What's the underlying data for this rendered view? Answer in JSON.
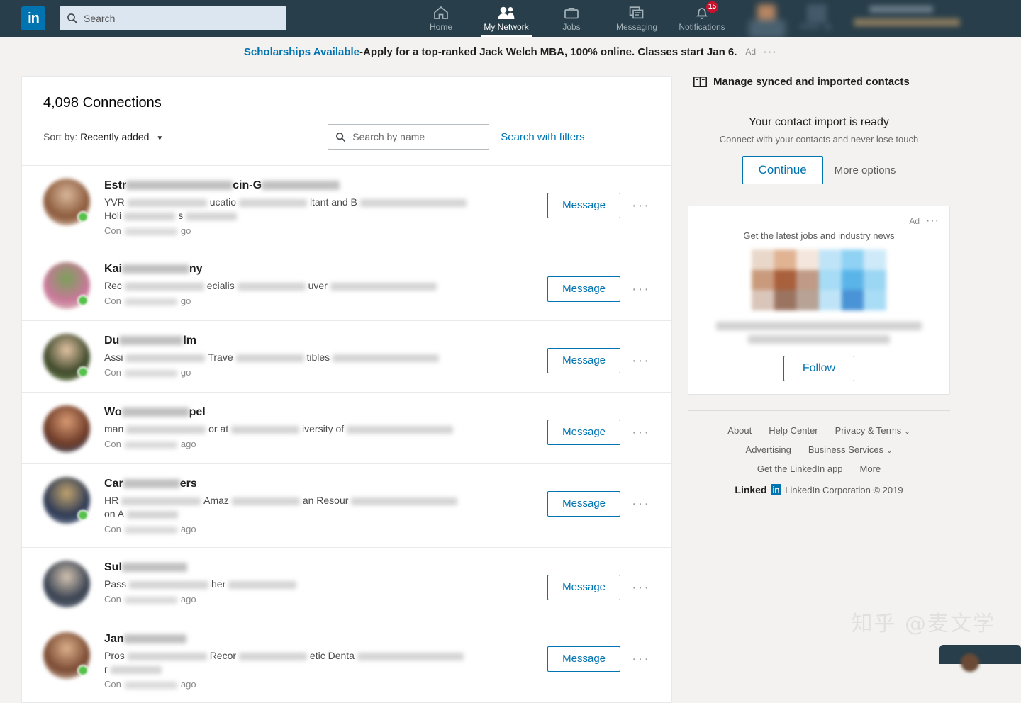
{
  "nav": {
    "logo_text": "in",
    "search_placeholder": "Search",
    "search_value": "",
    "items": [
      {
        "label": "Home",
        "icon": "home-icon",
        "active": false,
        "badge": ""
      },
      {
        "label": "My Network",
        "icon": "people-icon",
        "active": true,
        "badge": ""
      },
      {
        "label": "Jobs",
        "icon": "briefcase-icon",
        "active": false,
        "badge": ""
      },
      {
        "label": "Messaging",
        "icon": "chat-icon",
        "active": false,
        "badge": ""
      },
      {
        "label": "Notifications",
        "icon": "bell-icon",
        "active": false,
        "badge": "15"
      }
    ],
    "badge_color": "#cb112d",
    "bar_color": "#283e4a"
  },
  "ad_banner": {
    "headline": "Scholarships Available",
    "separator": " - ",
    "body": "Apply for a top-ranked Jack Welch MBA, 100% online. Classes start Jan 6.",
    "ad_tag": "Ad",
    "overflow": "···"
  },
  "connections": {
    "title": "4,098 Connections",
    "sort_label": "Sort by:",
    "sort_value": "Recently added",
    "sort_caret": "▼",
    "search_placeholder": "Search by name",
    "search_value": "",
    "filters_link": "Search with filters",
    "message_label": "Message",
    "row_overflow": "···",
    "rows": [
      {
        "name_visible": "Estr",
        "name_mid": "cin-G",
        "title_parts": [
          "YVR",
          "ucatio",
          "ltant and B"
        ],
        "title_line2": [
          "Holi",
          "s"
        ],
        "connected_prefix": "Con",
        "connected_suffix": "go",
        "avatar_colors": [
          "#8c5a3c",
          "#d9b79a",
          "#f0e2d5"
        ],
        "presence": true
      },
      {
        "name_visible": "Kai",
        "name_mid": "ny",
        "title_parts": [
          "Rec",
          "ecialis",
          "uver"
        ],
        "title_line2": [],
        "connected_prefix": "Con",
        "connected_suffix": "go",
        "avatar_colors": [
          "#c9789a",
          "#7aa05a",
          "#e8e2d2"
        ],
        "presence": true
      },
      {
        "name_visible": "Du",
        "name_mid": "lm",
        "title_parts": [
          "Assi",
          "Trave",
          "tibles"
        ],
        "title_line2": [],
        "connected_prefix": "Con",
        "connected_suffix": "go",
        "avatar_colors": [
          "#3f4a2c",
          "#e3c3a4",
          "#8aa36b"
        ],
        "presence": true
      },
      {
        "name_visible": "Wo",
        "name_mid": "pel",
        "title_parts": [
          "man",
          "or at",
          "iversity of"
        ],
        "title_line2": [],
        "connected_prefix": "Con",
        "connected_suffix": "ago",
        "avatar_colors": [
          "#6e3b28",
          "#d89a73",
          "#3b5e86"
        ],
        "presence": false
      },
      {
        "name_visible": "Car",
        "name_mid": "ers",
        "title_parts": [
          "HR",
          "Amaz",
          "an Resour"
        ],
        "title_line2": [
          "on A"
        ],
        "connected_prefix": "Con",
        "connected_suffix": "ago",
        "avatar_colors": [
          "#2e3a55",
          "#c2a46e",
          "#8d9ab0"
        ],
        "presence": true
      },
      {
        "name_visible": "Sul",
        "name_mid": "",
        "title_parts": [
          "Pass",
          "her"
        ],
        "title_line2": [],
        "connected_prefix": "Con",
        "connected_suffix": "ago",
        "avatar_colors": [
          "#3a4352",
          "#d3c3b0",
          "#7d8590"
        ],
        "presence": false
      },
      {
        "name_visible": "Jan",
        "name_mid": "",
        "title_parts": [
          "Pros",
          "Recor",
          "etic Denta"
        ],
        "title_line2": [
          "r"
        ],
        "connected_prefix": "Con",
        "connected_suffix": "ago",
        "avatar_colors": [
          "#7a4a32",
          "#dcb08c",
          "#efe0d2"
        ],
        "presence": true
      }
    ]
  },
  "rail": {
    "manage_link": "Manage synced and imported contacts",
    "manage_icon": "address-book-icon",
    "import_title": "Your contact import is ready",
    "import_sub": "Connect with your contacts and never lose touch",
    "continue_label": "Continue",
    "more_options_label": "More options",
    "ad_card": {
      "ad_tag": "Ad",
      "overflow": "···",
      "headline": "Get the latest jobs and industry news",
      "follow_label": "Follow"
    },
    "footer": {
      "row1": [
        "About",
        "Help Center",
        "Privacy & Terms"
      ],
      "row2": [
        "Advertising",
        "Business Services"
      ],
      "row3": [
        "Get the LinkedIn app",
        "More"
      ],
      "chevron": "⌄",
      "brand_word": "Linked",
      "brand_mini": "in",
      "copyright": "LinkedIn Corporation © 2019"
    }
  },
  "watermark": "知乎 @麦文学",
  "colors": {
    "nav_bg": "#283e4a",
    "page_bg": "#f3f2f0",
    "link": "#0073b1",
    "badge": "#cb112d",
    "presence": "#57c14b"
  }
}
